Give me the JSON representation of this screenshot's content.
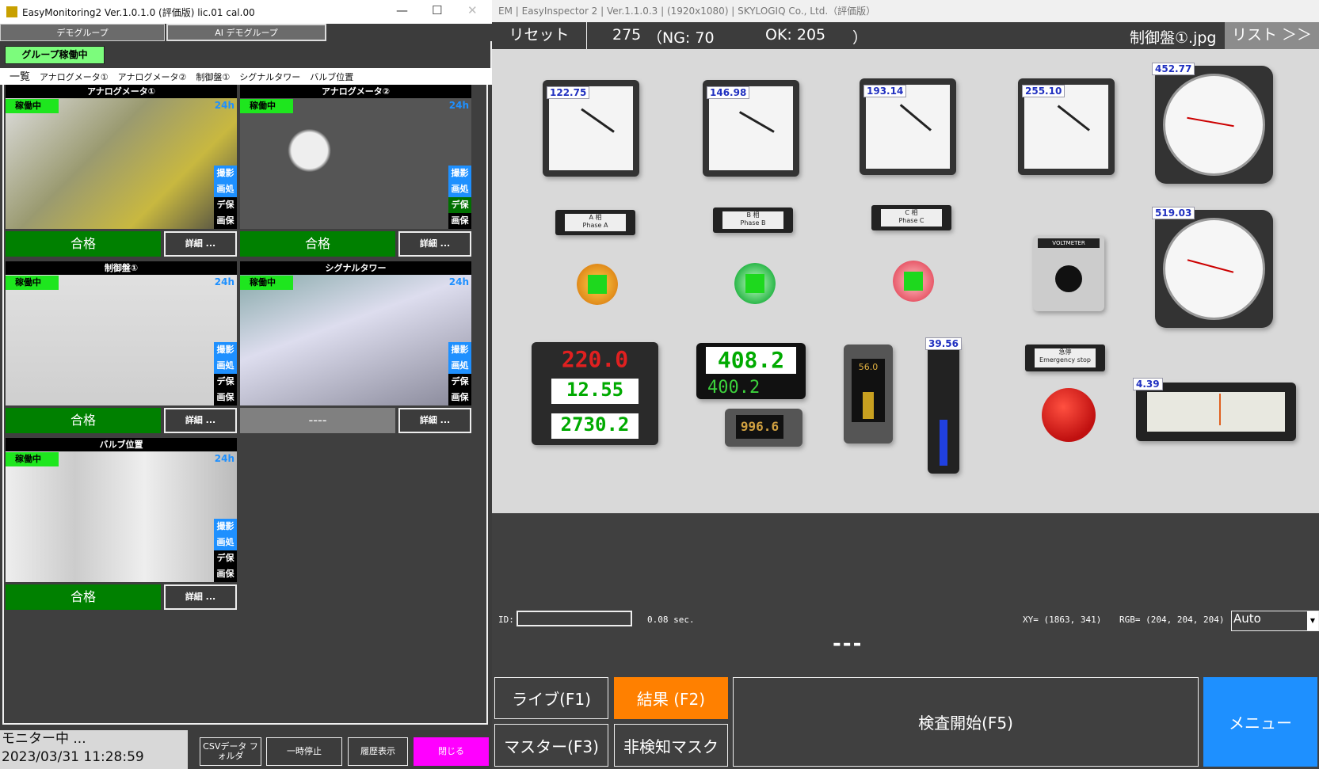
{
  "monitor": {
    "title": "EasyMonitoring2 Ver.1.0.1.0 (評価版)  lic.01 cal.00",
    "group_tabs": [
      "デモグループ",
      "AI デモグループ"
    ],
    "group_status": "グループ稼働中",
    "sub_tabs": [
      "一覧",
      "アナログメータ①",
      "アナログメータ②",
      "制御盤①",
      "シグナルタワー",
      "バルブ位置"
    ],
    "tiles": [
      {
        "title": "アナログメータ①",
        "status": "稼働中",
        "badge": "24h",
        "flags": [
          "撮影",
          "画処",
          "デ保",
          "画保"
        ],
        "result": "合格",
        "detail": "詳細 ..."
      },
      {
        "title": "アナログメータ②",
        "status": "稼働中",
        "badge": "24h",
        "flags": [
          "撮影",
          "画処",
          "デ保",
          "画保"
        ],
        "result": "合格",
        "detail": "詳細 ..."
      },
      {
        "title": "制御盤①",
        "status": "稼働中",
        "badge": "24h",
        "flags": [
          "撮影",
          "画処",
          "デ保",
          "画保"
        ],
        "result": "合格",
        "detail": "詳細 ..."
      },
      {
        "title": "シグナルタワー",
        "status": "稼働中",
        "badge": "24h",
        "flags": [
          "撮影",
          "画処",
          "デ保",
          "画保"
        ],
        "result": "----",
        "detail": "詳細 ..."
      },
      {
        "title": "バルブ位置",
        "status": "稼働中",
        "badge": "24h",
        "flags": [
          "撮影",
          "画処",
          "デ保",
          "画保"
        ],
        "result": "合格",
        "detail": "詳細 ..."
      }
    ],
    "status_text": "モニター中 ...",
    "datetime": "2023/03/31 11:28:59",
    "buttons": {
      "csv": "CSVデータ フォルダ",
      "pause": "一時停止",
      "history": "履歴表示",
      "close": "閉じる"
    }
  },
  "inspector": {
    "title": "EM | EasyInspector 2 | Ver.1.1.0.3 | (1920x1080) | SKYLOGIQ Co., Ltd.（評価版）",
    "reset": "リセット",
    "total": "275",
    "ng": "（NG: 70",
    "ok": "OK: 205",
    "close_paren": "）",
    "filename": "制御盤①.jpg",
    "list": "リスト ＞＞",
    "readings": [
      "122.75",
      "146.98",
      "193.14",
      "255.10",
      "452.77",
      "519.03",
      "39.56",
      "4.39"
    ],
    "phases": [
      {
        "jp": "A 相",
        "en": "Phase A"
      },
      {
        "jp": "B 相",
        "en": "Phase B"
      },
      {
        "jp": "C 相",
        "en": "Phase C"
      }
    ],
    "digital": {
      "voltage": "220.0",
      "current": "12.55",
      "power": "2730.2",
      "pv": "408.2",
      "sv": "400.2",
      "temp": "996.6",
      "level": "56.0"
    },
    "voltmeter": "VOLTMETER",
    "estop": {
      "jp": "急停",
      "en": "Emergency stop"
    },
    "id_label": "ID:",
    "id_value": "",
    "elapsed": "0.08 sec.",
    "xy": "XY= (1863,  341)",
    "rgb": "RGB= (204, 204, 204)",
    "mode": "Auto",
    "judgement": "---",
    "buttons": {
      "live": "ライブ(F1)",
      "result": "結果 (F2)",
      "start": "検査開始(F5)",
      "menu": "メニュー",
      "master": "マスター(F3)",
      "mask": "非検知マスク"
    }
  },
  "colors": {
    "ok": "#008000",
    "running": "#1ee61e",
    "accent_orange": "#ff8000",
    "menu_blue": "#1e90ff",
    "close_magenta": "#ff00ff"
  }
}
